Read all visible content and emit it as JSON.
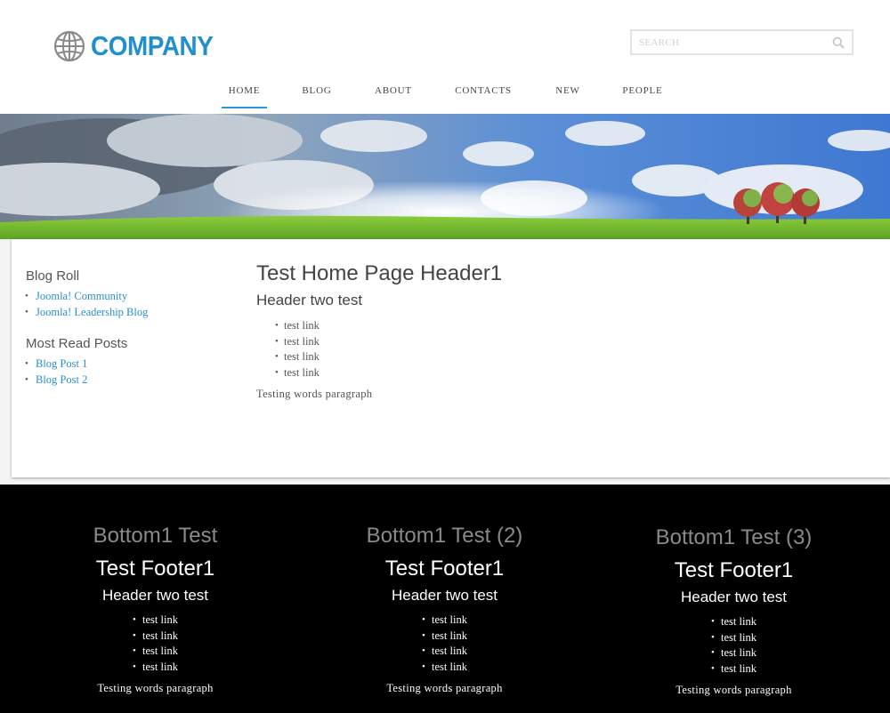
{
  "brand": {
    "name": "COMPANY",
    "logo_icon": "globe-icon",
    "accent": "#1f8fcf"
  },
  "search": {
    "placeholder": "SEARCH",
    "icon": "search-icon"
  },
  "nav": {
    "items": [
      {
        "label": "HOME",
        "active": true
      },
      {
        "label": "BLOG",
        "active": false
      },
      {
        "label": "ABOUT",
        "active": false
      },
      {
        "label": "CONTACTS",
        "active": false
      },
      {
        "label": "NEW",
        "active": false
      },
      {
        "label": "PEOPLE",
        "active": false
      }
    ]
  },
  "sidebar": {
    "blog_roll": {
      "title": "Blog Roll",
      "links": [
        "Joomla! Community",
        "Joomla! Leadership Blog"
      ]
    },
    "most_read": {
      "title": "Most Read Posts",
      "links": [
        "Blog Post 1",
        "Blog Post 2"
      ]
    }
  },
  "main": {
    "h1": "Test Home Page Header1",
    "h2": "Header two test",
    "links": [
      "test link",
      "test link",
      "test link",
      "test link"
    ],
    "paragraph": "Testing words paragraph"
  },
  "footer": {
    "columns": [
      {
        "bottom_title": "Bottom1 Test",
        "title": "Test Footer1",
        "h2": "Header two test",
        "links": [
          "test link",
          "test link",
          "test link",
          "test link"
        ],
        "paragraph": "Testing words paragraph"
      },
      {
        "bottom_title": "Bottom1 Test (2)",
        "title": "Test Footer1",
        "h2": "Header two test",
        "links": [
          "test link",
          "test link",
          "test link",
          "test link"
        ],
        "paragraph": "Testing words paragraph"
      },
      {
        "bottom_title": "Bottom1 Test (3)",
        "title": "Test Footer1",
        "h2": "Header two test",
        "links": [
          "test link",
          "test link",
          "test link",
          "test link"
        ],
        "paragraph": "Testing words paragraph"
      }
    ]
  }
}
